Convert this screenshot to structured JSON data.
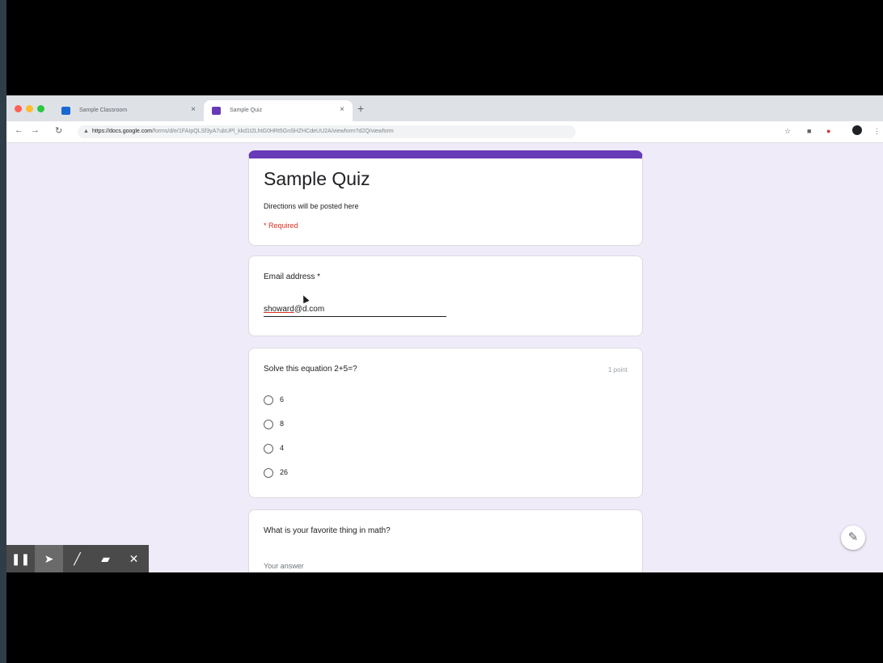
{
  "browser": {
    "tabs": [
      {
        "label": "Sample Classroom",
        "favicon_color": "#1967d2",
        "active": false
      },
      {
        "label": "Sample Quiz",
        "favicon_color": "#673ab7",
        "active": true
      }
    ],
    "new_tab_icon": "plus-icon",
    "url_host": "https://docs.google.com",
    "url_path": "/forms/d/e/1FAIpQLSf3yA7ubUPl_kkd1t2LhtG0HRt5GnSHZHCdeUU2A/viewform?d2Q/viewform"
  },
  "form": {
    "title": "Sample Quiz",
    "description": "Directions will be posted here",
    "required_note": "* Required",
    "accent_color": "#673ab7",
    "email": {
      "label": "Email address *",
      "value_underlined": "showard",
      "value_rest": "@d.com"
    },
    "question1": {
      "text": "Solve this equation 2+5=?",
      "points": "1 point",
      "options": [
        "6",
        "8",
        "4",
        "26"
      ]
    },
    "question2": {
      "text": "What is your favorite thing in math?",
      "placeholder": "Your answer"
    }
  },
  "annotation_toolbar": {
    "buttons": [
      "pause-icon",
      "cursor-icon",
      "pen-icon",
      "highlighter-icon",
      "close-icon"
    ]
  }
}
